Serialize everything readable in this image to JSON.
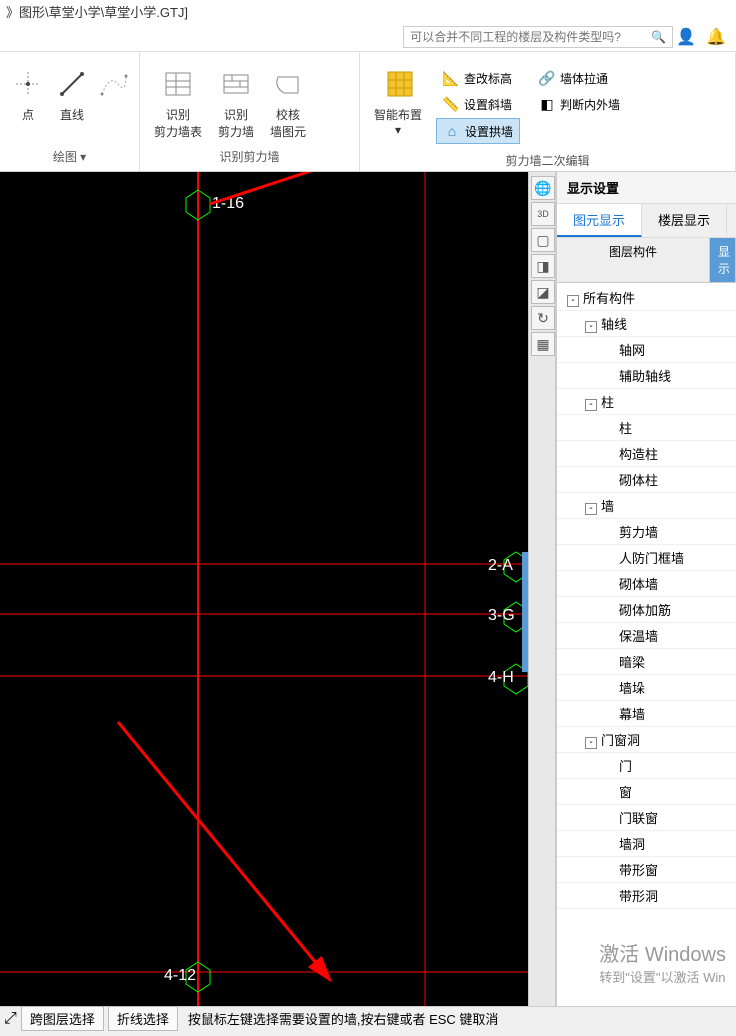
{
  "title": "》图形\\草堂小学\\草堂小学.GTJ]",
  "search": {
    "placeholder": "可以合并不同工程的楼层及构件类型吗?"
  },
  "ribbon": {
    "group1": {
      "label": "绘图 ▾",
      "buttons": [
        {
          "label": "点"
        },
        {
          "label": "直线"
        }
      ]
    },
    "group2": {
      "label": "识别剪力墙",
      "buttons": [
        {
          "label": "识别\n剪力墙表"
        },
        {
          "label": "识别\n剪力墙"
        },
        {
          "label": "校核\n墙图元"
        }
      ]
    },
    "group3": {
      "label": "剪力墙二次编辑",
      "big": {
        "label": "智能布置\n▾"
      },
      "col1": [
        {
          "label": "查改标高"
        },
        {
          "label": "设置斜墙"
        },
        {
          "label": "设置拱墙",
          "active": true
        }
      ],
      "col2": [
        {
          "label": "墙体拉通"
        },
        {
          "label": "判断内外墙"
        }
      ]
    }
  },
  "canvas": {
    "labels": {
      "top": "1-16",
      "r1": "2-A",
      "r2": "3-G",
      "r3": "4-H",
      "bottom": "4-12"
    }
  },
  "panel": {
    "title": "显示设置",
    "tabs": [
      {
        "label": "图元显示",
        "active": true
      },
      {
        "label": "楼层显示",
        "active": false
      }
    ],
    "header": {
      "col1": "图层构件",
      "col2": "显示"
    },
    "tree": [
      {
        "indent": 0,
        "toggle": "-",
        "label": "所有构件"
      },
      {
        "indent": 1,
        "toggle": "-",
        "label": "轴线"
      },
      {
        "indent": 2,
        "label": "轴网"
      },
      {
        "indent": 2,
        "label": "辅助轴线"
      },
      {
        "indent": 1,
        "toggle": "-",
        "label": "柱"
      },
      {
        "indent": 2,
        "label": "柱"
      },
      {
        "indent": 2,
        "label": "构造柱"
      },
      {
        "indent": 2,
        "label": "砌体柱"
      },
      {
        "indent": 1,
        "toggle": "-",
        "label": "墙"
      },
      {
        "indent": 2,
        "label": "剪力墙"
      },
      {
        "indent": 2,
        "label": "人防门框墙"
      },
      {
        "indent": 2,
        "label": "砌体墙"
      },
      {
        "indent": 2,
        "label": "砌体加筋"
      },
      {
        "indent": 2,
        "label": "保温墙"
      },
      {
        "indent": 2,
        "label": "暗梁"
      },
      {
        "indent": 2,
        "label": "墙垛"
      },
      {
        "indent": 2,
        "label": "幕墙"
      },
      {
        "indent": 1,
        "toggle": "-",
        "label": "门窗洞"
      },
      {
        "indent": 2,
        "label": "门"
      },
      {
        "indent": 2,
        "label": "窗"
      },
      {
        "indent": 2,
        "label": "门联窗"
      },
      {
        "indent": 2,
        "label": "墙洞"
      },
      {
        "indent": 2,
        "label": "带形窗"
      },
      {
        "indent": 2,
        "label": "带形洞"
      }
    ]
  },
  "watermark": {
    "main": "激活 Windows",
    "sub": "转到\"设置\"以激活 Win"
  },
  "status": {
    "btn1": "跨图层选择",
    "btn2": "折线选择",
    "text": "按鼠标左键选择需要设置的墙,按右键或者 ESC 键取消"
  }
}
